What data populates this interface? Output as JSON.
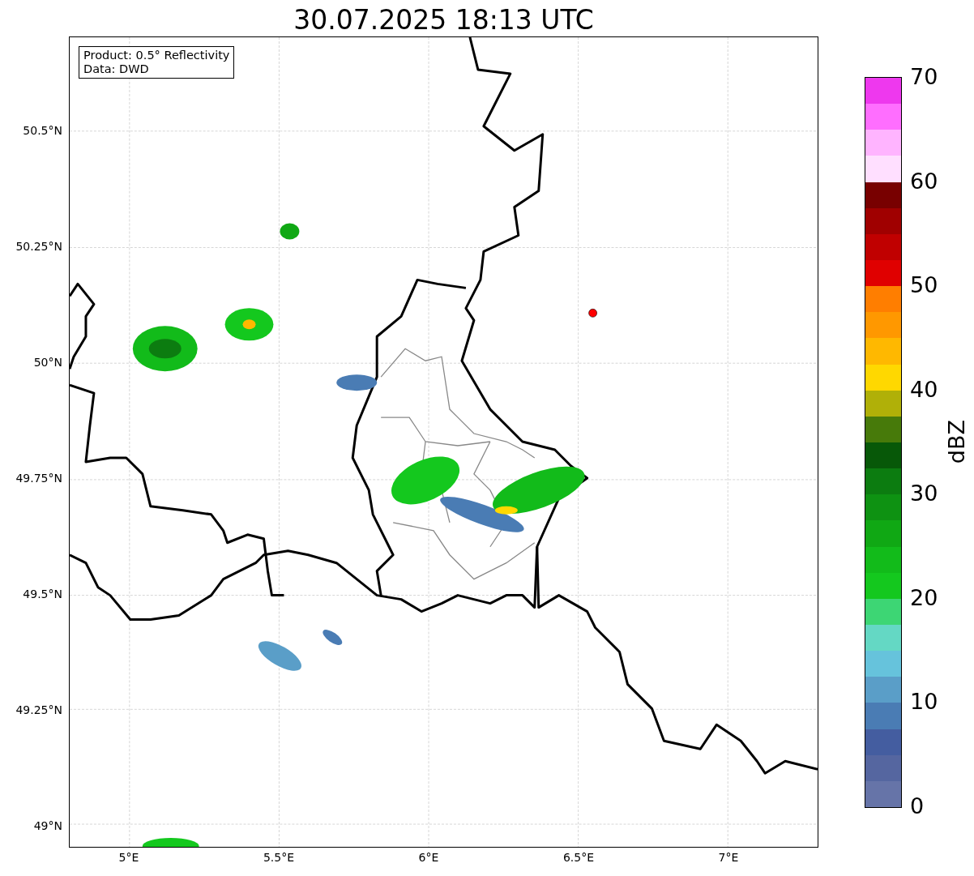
{
  "title": "30.07.2025 18:13 UTC",
  "legend": [
    "Product: 0.5° Reflectivity",
    "Data: DWD"
  ],
  "map": {
    "lat_ticks": [
      "50.5°N",
      "50.25°N",
      "50°N",
      "49.75°N",
      "49.5°N",
      "49.25°N",
      "49°N"
    ],
    "lon_ticks": [
      "5°E",
      "5.5°E",
      "6°E",
      "6.5°E",
      "7°E"
    ]
  },
  "colorbar": {
    "label": "dBZ",
    "ticks": [
      "70",
      "60",
      "50",
      "40",
      "30",
      "20",
      "10",
      "0"
    ]
  }
}
